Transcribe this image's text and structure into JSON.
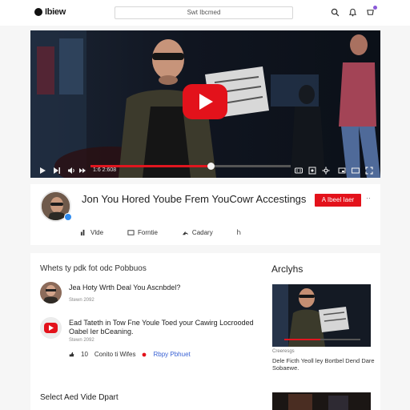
{
  "header": {
    "logo_text": "Ibiew",
    "search_placeholder": "Swt Ibcmed",
    "icons": [
      "search-icon",
      "notifications-icon",
      "cart-icon"
    ],
    "badge_color": "#8a5ad8"
  },
  "player": {
    "time": "1:6 2:608",
    "progress": 0.6,
    "accent": "#e3121b"
  },
  "video": {
    "title": "Jon You Hored Yoube Frem YouCowr Accestings",
    "subscribe_label": "A Ibeel Iaer",
    "more_label": "··",
    "actions": {
      "like": "Vlde",
      "forums": "Forntie",
      "calary": "Cadary",
      "fourth": "Ⴙ"
    }
  },
  "comments": {
    "header": "Whets ty pdk fot odc Pobbuos",
    "items": [
      {
        "text": "Jea Hoty Wrth Deal You Ascnbdel?",
        "meta": "Stewn 2092"
      },
      {
        "text": "Ead Tateth in Tow Fne Youle Toed your Cawirg Locrooded Oabel Ier bCeaning.",
        "meta": "Stewn 2092",
        "count": "10",
        "view_label": "Conito ti Wifes",
        "reply_label": "Rbpy Pbhuet"
      }
    ],
    "footer": "Select Aed Vide Dpart"
  },
  "related": {
    "heading": "Arclyhs",
    "channel": "Creeresgs",
    "title": "Dele Ficth Yeoll ley Bortbel Dend Dare Sobaewe."
  }
}
